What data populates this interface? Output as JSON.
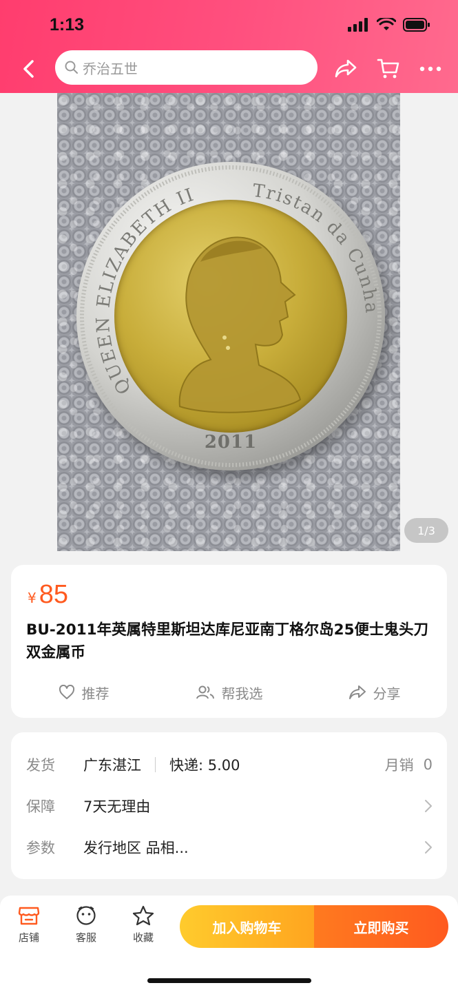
{
  "status_bar": {
    "time": "1:13"
  },
  "nav": {
    "search_placeholder": "乔治五世",
    "icons": [
      "back-icon",
      "share-icon",
      "cart-icon",
      "more-icon"
    ]
  },
  "gallery": {
    "page_indicator": "1/3",
    "coin_year": "2011",
    "coin_inscription_left": "QUEEN ELIZABETH II",
    "coin_inscription_right": "Tristan da Cunha"
  },
  "product": {
    "currency_symbol": "¥",
    "price": "85",
    "title": "BU-2011年英属特里斯坦达库尼亚南丁格尔岛25便士鬼头刀双金属币",
    "actions": [
      {
        "icon": "heart-icon",
        "label": "推荐"
      },
      {
        "icon": "people-icon",
        "label": "帮我选"
      },
      {
        "icon": "share-icon",
        "label": "分享"
      }
    ]
  },
  "info": {
    "shipping_label": "发货",
    "shipping_from": "广东湛江",
    "shipping_fee": "快递: 5.00",
    "monthly_sales_label": "月销",
    "monthly_sales": "0",
    "guarantee_label": "保障",
    "guarantee_value": "7天无理由",
    "params_label": "参数",
    "params_value": "发行地区 品相..."
  },
  "bottom_bar": {
    "tabs": [
      {
        "icon": "store-icon",
        "label": "店铺"
      },
      {
        "icon": "service-icon",
        "label": "客服"
      },
      {
        "icon": "star-icon",
        "label": "收藏"
      }
    ],
    "add_to_cart": "加入购物车",
    "buy_now": "立即购买"
  },
  "colors": {
    "header_accent": "#ff4f7e",
    "price": "#ff5a1f",
    "cart_button": "#ffb824",
    "buy_button": "#ff6a1f"
  }
}
